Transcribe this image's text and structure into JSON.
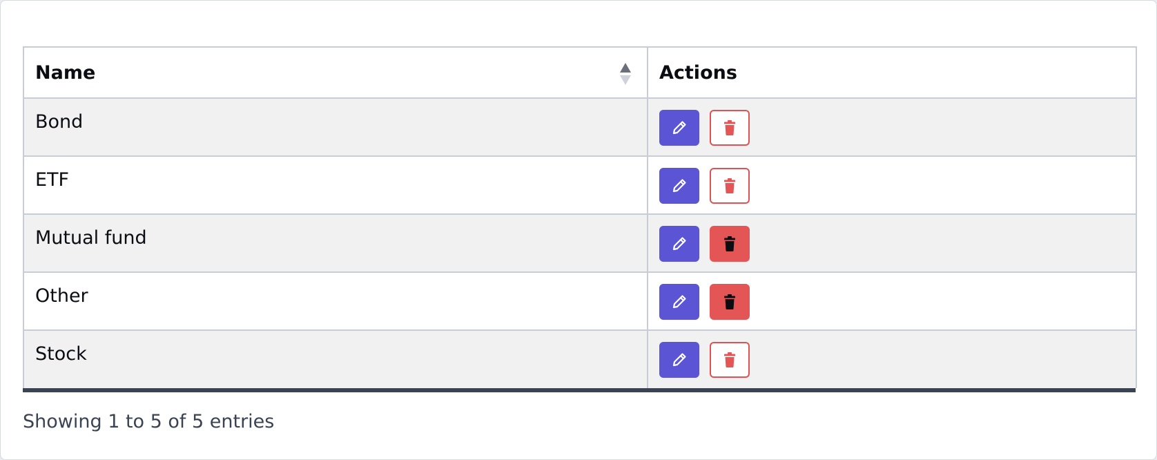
{
  "table": {
    "headers": {
      "name": "Name",
      "actions": "Actions"
    },
    "rows": [
      {
        "name": "Bond",
        "delete_style": "outline"
      },
      {
        "name": "ETF",
        "delete_style": "outline"
      },
      {
        "name": "Mutual fund",
        "delete_style": "solid"
      },
      {
        "name": "Other",
        "delete_style": "solid"
      },
      {
        "name": "Stock",
        "delete_style": "outline"
      }
    ],
    "icons": {
      "sort": "sort-icon",
      "edit": "pencil-icon",
      "delete": "trash-icon"
    }
  },
  "footer": {
    "info": "Showing 1 to 5 of 5 entries"
  },
  "colors": {
    "edit_button": "#5b55d6",
    "delete_red": "#e45555",
    "bottom_bar": "#3b4353"
  }
}
